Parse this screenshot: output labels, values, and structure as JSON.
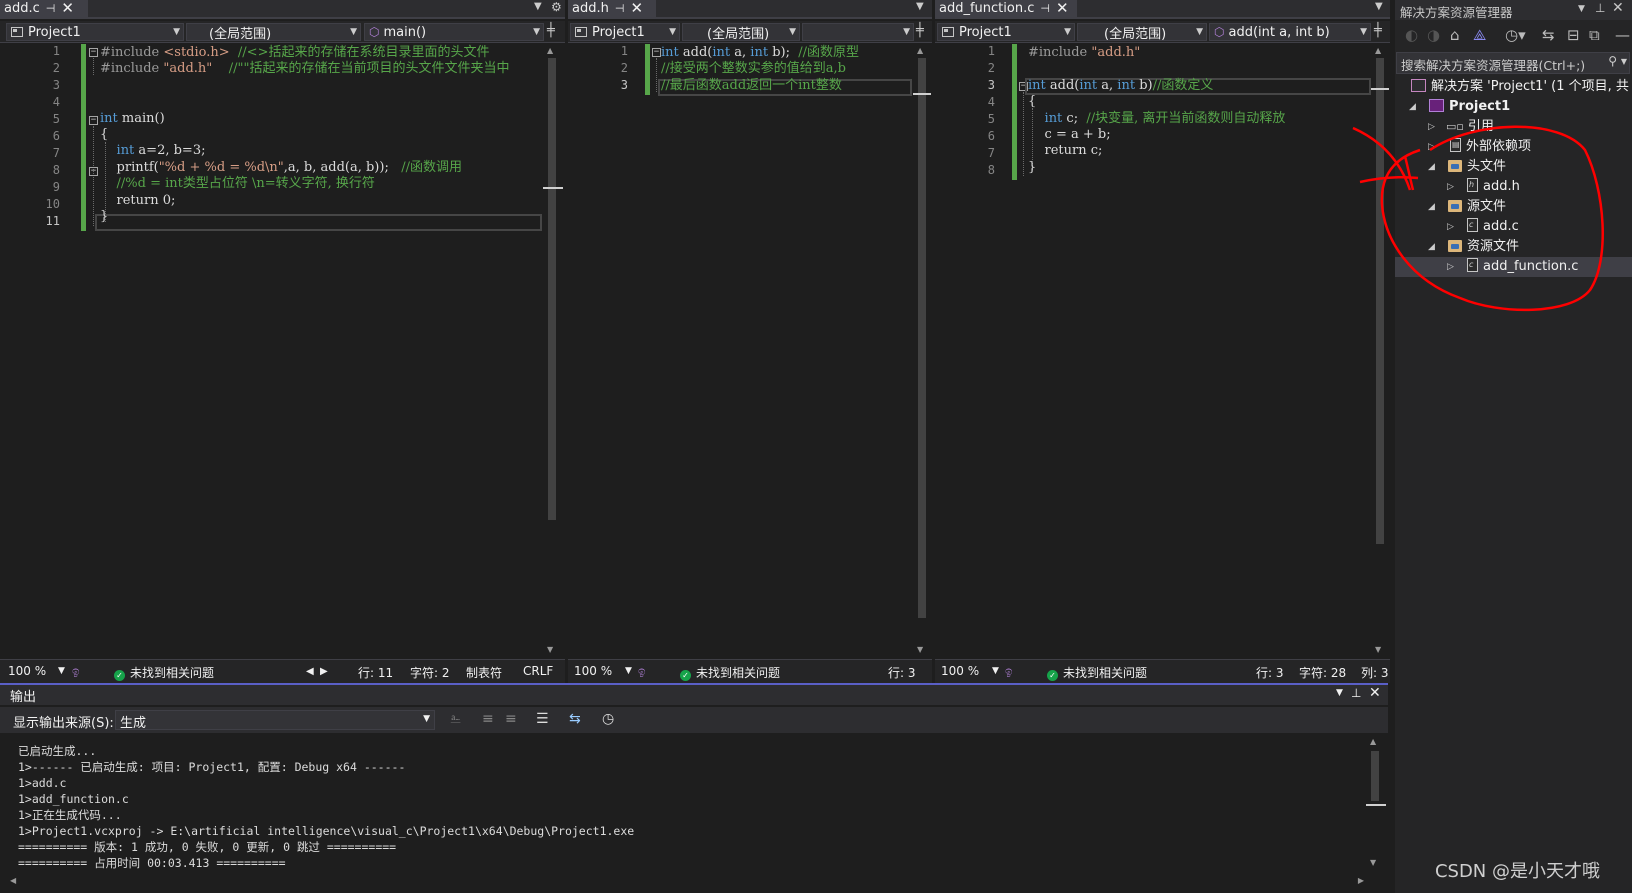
{
  "panes": [
    {
      "tab": "add.c",
      "project": "Project1",
      "scope": "(全局范围)",
      "member": "main()",
      "zoom": "100 %",
      "issues": "未找到相关问题",
      "row": "行: 11",
      "char": "字符: 2",
      "tabs": "制表符",
      "eol": "CRLF",
      "line_numbers": [
        "1",
        "2",
        "3",
        "4",
        "5",
        "6",
        "7",
        "8",
        "9",
        "10",
        "11"
      ],
      "lines": [
        [
          {
            "t": "#include ",
            "c": "pp"
          },
          {
            "t": "<stdio.h>",
            "c": "inc"
          },
          {
            "t": "  //<>括起来的存储在系统目录里面的头文件",
            "c": "cm"
          }
        ],
        [
          {
            "t": "#include ",
            "c": "pp"
          },
          {
            "t": "\"add.h\"",
            "c": "inc"
          },
          {
            "t": "    //\"\"括起来的存储在当前项目的头文件文件夹当中",
            "c": "cm"
          }
        ],
        [],
        [],
        [
          {
            "t": "int",
            "c": "kw"
          },
          {
            "t": " main()",
            "c": "tx"
          }
        ],
        [
          {
            "t": "{",
            "c": "tx"
          }
        ],
        [
          {
            "t": "    ",
            "c": "tx"
          },
          {
            "t": "int",
            "c": "kw"
          },
          {
            "t": " a=2, b=3;",
            "c": "tx"
          }
        ],
        [
          {
            "t": "    printf(",
            "c": "tx"
          },
          {
            "t": "\"%d + %d = %d\\n\"",
            "c": "str"
          },
          {
            "t": ",a, b, add(a, b));   ",
            "c": "tx"
          },
          {
            "t": "//函数调用",
            "c": "cm"
          }
        ],
        [
          {
            "t": "    //%d = int类型占位符 \\n=转义字符, 换行符",
            "c": "cm"
          }
        ],
        [
          {
            "t": "    return 0;",
            "c": "tx"
          }
        ],
        [
          {
            "t": "}",
            "c": "tx"
          }
        ]
      ]
    },
    {
      "tab": "add.h",
      "project": "Project1",
      "scope": "(全局范围)",
      "member": "",
      "zoom": "100 %",
      "issues": "未找到相关问题",
      "row": "行: 3",
      "line_numbers": [
        "1",
        "2",
        "3"
      ],
      "lines": [
        [
          {
            "t": "int",
            "c": "kw"
          },
          {
            "t": " add(",
            "c": "tx"
          },
          {
            "t": "int",
            "c": "kw"
          },
          {
            "t": " a, ",
            "c": "tx"
          },
          {
            "t": "int",
            "c": "kw"
          },
          {
            "t": " b);  ",
            "c": "tx"
          },
          {
            "t": "//函数原型",
            "c": "cm"
          }
        ],
        [
          {
            "t": "//接受两个整数实参的值给到a,b",
            "c": "cm"
          }
        ],
        [
          {
            "t": "//最后函数add返回一个int整数",
            "c": "cm"
          }
        ]
      ]
    },
    {
      "tab": "add_function.c",
      "project": "Project1",
      "scope": "(全局范围)",
      "member": "add(int a, int b)",
      "zoom": "100 %",
      "issues": "未找到相关问题",
      "row": "行: 3",
      "char": "字符: 28",
      "col": "列: 3",
      "line_numbers": [
        "1",
        "2",
        "3",
        "4",
        "5",
        "6",
        "7",
        "8"
      ],
      "lines": [
        [
          {
            "t": "#include ",
            "c": "pp"
          },
          {
            "t": "\"add.h\"",
            "c": "inc"
          }
        ],
        [],
        [
          {
            "t": "int",
            "c": "kw"
          },
          {
            "t": " add(",
            "c": "tx"
          },
          {
            "t": "int",
            "c": "kw"
          },
          {
            "t": " a, ",
            "c": "tx"
          },
          {
            "t": "int",
            "c": "kw"
          },
          {
            "t": " b)",
            "c": "tx"
          },
          {
            "t": "//函数定义",
            "c": "cm"
          }
        ],
        [
          {
            "t": "{",
            "c": "tx"
          }
        ],
        [
          {
            "t": "    ",
            "c": "tx"
          },
          {
            "t": "int",
            "c": "kw"
          },
          {
            "t": " c;  ",
            "c": "tx"
          },
          {
            "t": "//块变量, 离开当前函数则自动释放",
            "c": "cm"
          }
        ],
        [
          {
            "t": "    c = a + b;",
            "c": "tx"
          }
        ],
        [
          {
            "t": "    return c;",
            "c": "tx"
          }
        ],
        [
          {
            "t": "}",
            "c": "tx"
          }
        ]
      ]
    }
  ],
  "output": {
    "title": "输出",
    "source_label": "显示输出来源(S):",
    "source_value": "生成",
    "lines": [
      "已启动生成...",
      "1>------ 已启动生成: 项目: Project1, 配置: Debug x64 ------",
      "1>add.c",
      "1>add_function.c",
      "1>正在生成代码...",
      "1>Project1.vcxproj -> E:\\artificial intelligence\\visual_c\\Project1\\x64\\Debug\\Project1.exe",
      "========== 版本: 1 成功, 0 失败, 0 更新, 0 跳过 ==========",
      "========== 占用时间 00:03.413 =========="
    ]
  },
  "solution_explorer": {
    "title": "解决方案资源管理器",
    "search_placeholder": "搜索解决方案资源管理器(Ctrl+;)",
    "solution": "解决方案 'Project1' (1 个项目, 共",
    "project": "Project1",
    "references": "引用",
    "external_deps": "外部依赖项",
    "headers": "头文件",
    "header_file": "add.h",
    "sources": "源文件",
    "source_file": "add.c",
    "resources": "资源文件",
    "resource_file": "add_function.c"
  },
  "watermark": "CSDN @是小天才哦",
  "annotation_color": "#ff0000",
  "accent": "#57a64a"
}
